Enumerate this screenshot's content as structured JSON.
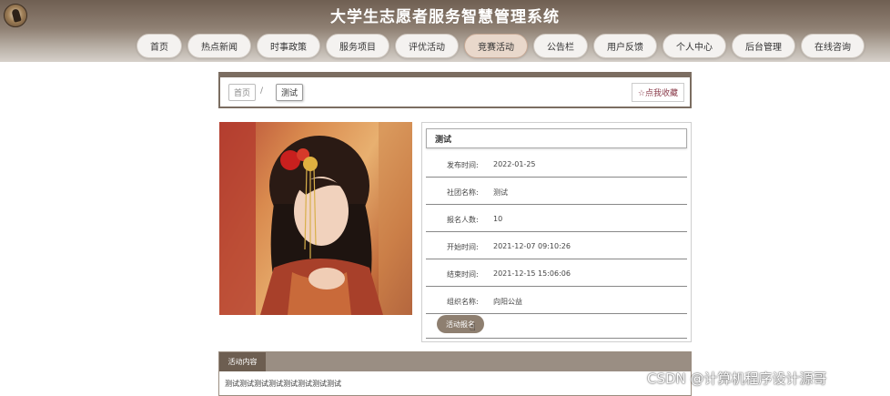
{
  "header": {
    "title": "大学生志愿者服务智慧管理系统"
  },
  "nav": [
    {
      "label": "首页"
    },
    {
      "label": "热点新闻"
    },
    {
      "label": "时事政策"
    },
    {
      "label": "服务项目"
    },
    {
      "label": "评优活动"
    },
    {
      "label": "竞赛活动",
      "active": true
    },
    {
      "label": "公告栏"
    },
    {
      "label": "用户反馈"
    },
    {
      "label": "个人中心"
    },
    {
      "label": "后台管理"
    },
    {
      "label": "在线咨询"
    }
  ],
  "breadcrumb": {
    "home": "首页",
    "separator": "/",
    "current": "测试"
  },
  "favorite_button": "☆点我收藏",
  "detail": {
    "title": "测试",
    "rows": [
      {
        "label": "发布时间:",
        "value": "2022-01-25"
      },
      {
        "label": "社团名称:",
        "value": "测试"
      },
      {
        "label": "报名人数:",
        "value": "10"
      },
      {
        "label": "开始时间:",
        "value": "2021-12-07 09:10:26"
      },
      {
        "label": "结束时间:",
        "value": "2021-12-15 15:06:06"
      },
      {
        "label": "组织名称:",
        "value": "向阳公益"
      }
    ],
    "signup_button": "活动报名"
  },
  "content": {
    "tab": "活动内容",
    "text": "测试测试测试测试测试测试测试测试"
  },
  "watermark": "CSDN @计算机程序设计源哥"
}
